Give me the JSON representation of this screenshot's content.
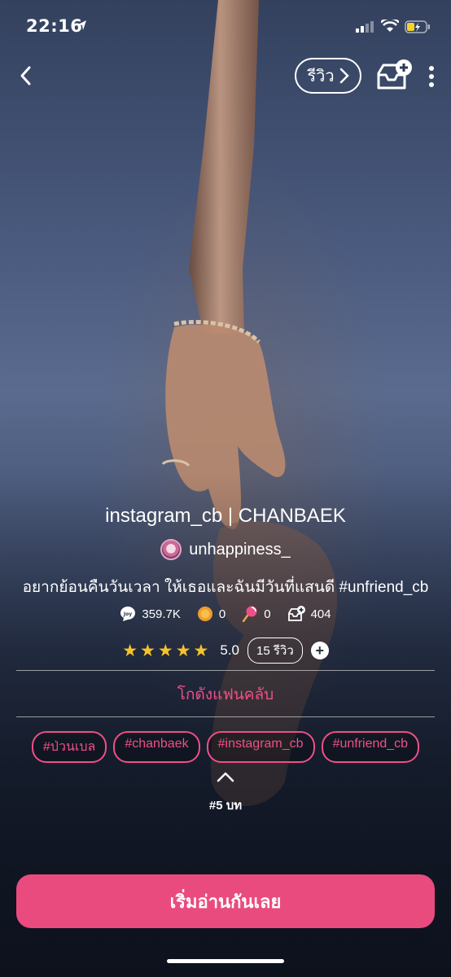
{
  "status": {
    "time": "22:16"
  },
  "header": {
    "review_label": "รีวิว"
  },
  "story": {
    "title": "instagram_cb | CHANBAEK",
    "author": "unhappiness_",
    "description": "อยากย้อนคืนวันเวลา ให้เธอและฉันมีวันที่แสนดี #unfriend_cb",
    "stats": {
      "views": "359.7K",
      "coins": "0",
      "candies": "0",
      "library_adds": "404"
    },
    "rating": {
      "stars": 5,
      "value": "5.0",
      "review_count": "15 รีวิว"
    },
    "fanclub_label": "โกดังแฟนคลับ",
    "tags": [
      "#ป่วนเบล",
      "#chanbaek",
      "#instagram_cb",
      "#unfriend_cb"
    ],
    "chapter_count": "#5 บท",
    "start_reading_label": "เริ่มอ่านกันเลย"
  },
  "colors": {
    "accent": "#ea4b7f",
    "star": "#f6c32b"
  },
  "icons": [
    "back-icon",
    "chevron-right-icon",
    "add-to-library-icon",
    "more-icon",
    "joy-icon",
    "coin-icon",
    "candy-icon",
    "library-icon",
    "star-icon",
    "plus-icon",
    "chevron-up-icon"
  ]
}
